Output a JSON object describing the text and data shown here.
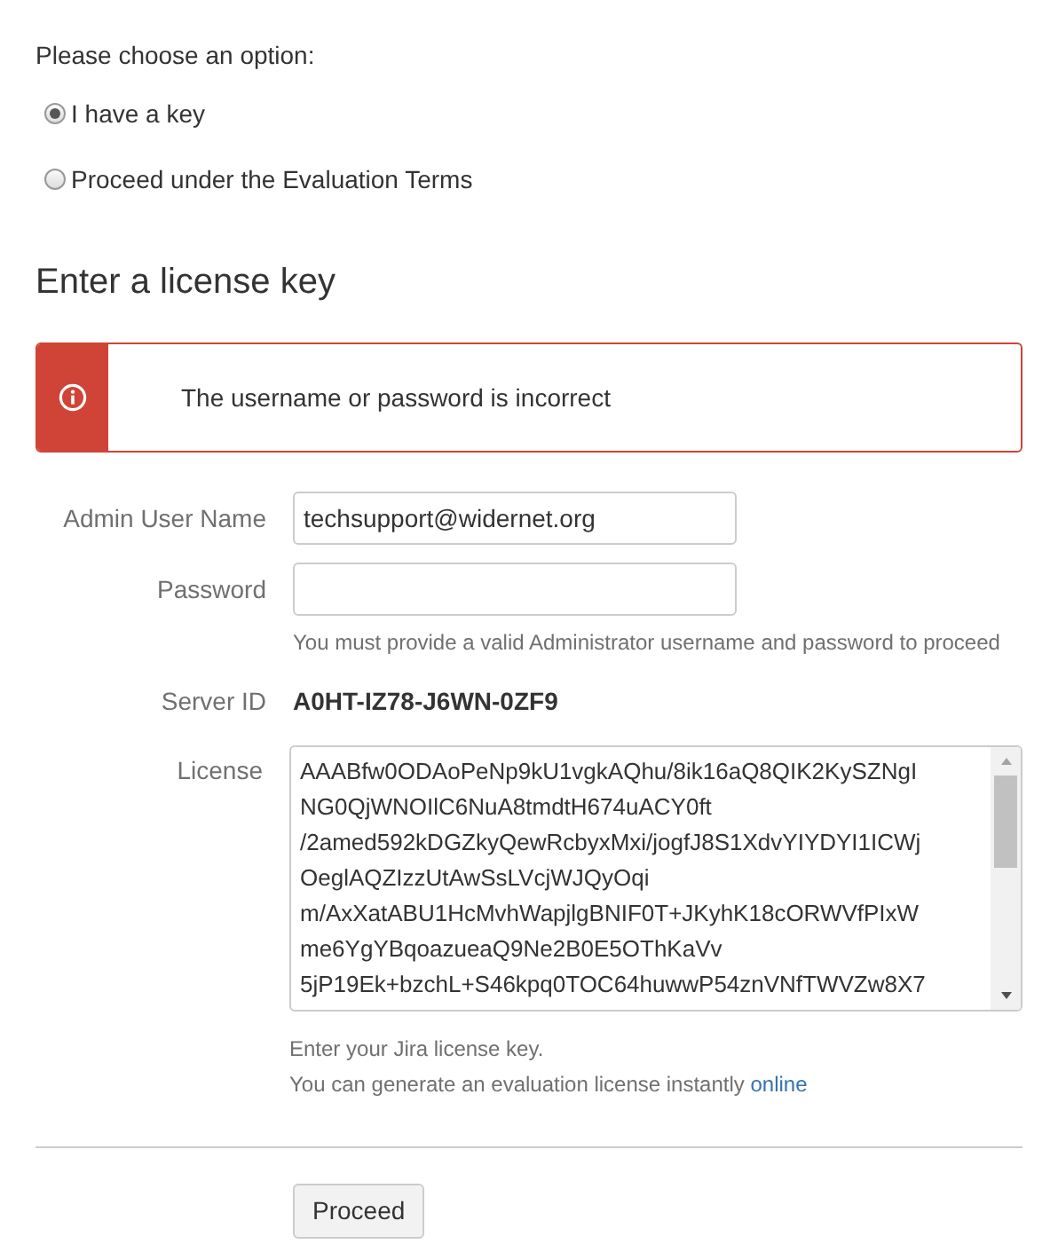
{
  "prompt": "Please choose an option:",
  "options": [
    {
      "label": "I have a key",
      "selected": true
    },
    {
      "label": "Proceed under the Evaluation Terms",
      "selected": false
    }
  ],
  "heading": "Enter a license key",
  "error": {
    "message": "The username or password is incorrect"
  },
  "fields": [
    {
      "label": "Admin User Name",
      "value": "techsupport@widernet.org"
    },
    {
      "label": "Password",
      "help": "You must provide a valid Administrator username and password to proceed"
    }
  ],
  "server_id": {
    "label": "Server ID",
    "value": "A0HT-IZ78-J6WN-0ZF9"
  },
  "license": {
    "label": "License",
    "lines": [
      "AAABfw0ODAoPeNp9kU1vgkAQhu/8ik16aQ8QIK2KySZNgI",
      "NG0QjWNOIlC6NuA8tmdtH674uACY0ft",
      "/2amed592kDGZkyQewRcbyxMxi/jogfJ8S1XdvYIYDYI1ICWj",
      "OeglAQZIzzUtAwSsLVcjWJQyOqi",
      "m/AxXatABU1HcMvhWapjlgBNIF0T+JKyhK18cORWVfPIxW",
      "me6YgYBqoazueaQ9Ne2B0E5OThKaVv",
      "5jP19Ek+bzchL+S46kpq0TOC64huwwP54znVNfTWVZw8X7"
    ],
    "help": "Enter your Jira license key.",
    "eval_text": "You can generate an evaluation license instantly",
    "eval_link": "online"
  },
  "button": "Proceed"
}
